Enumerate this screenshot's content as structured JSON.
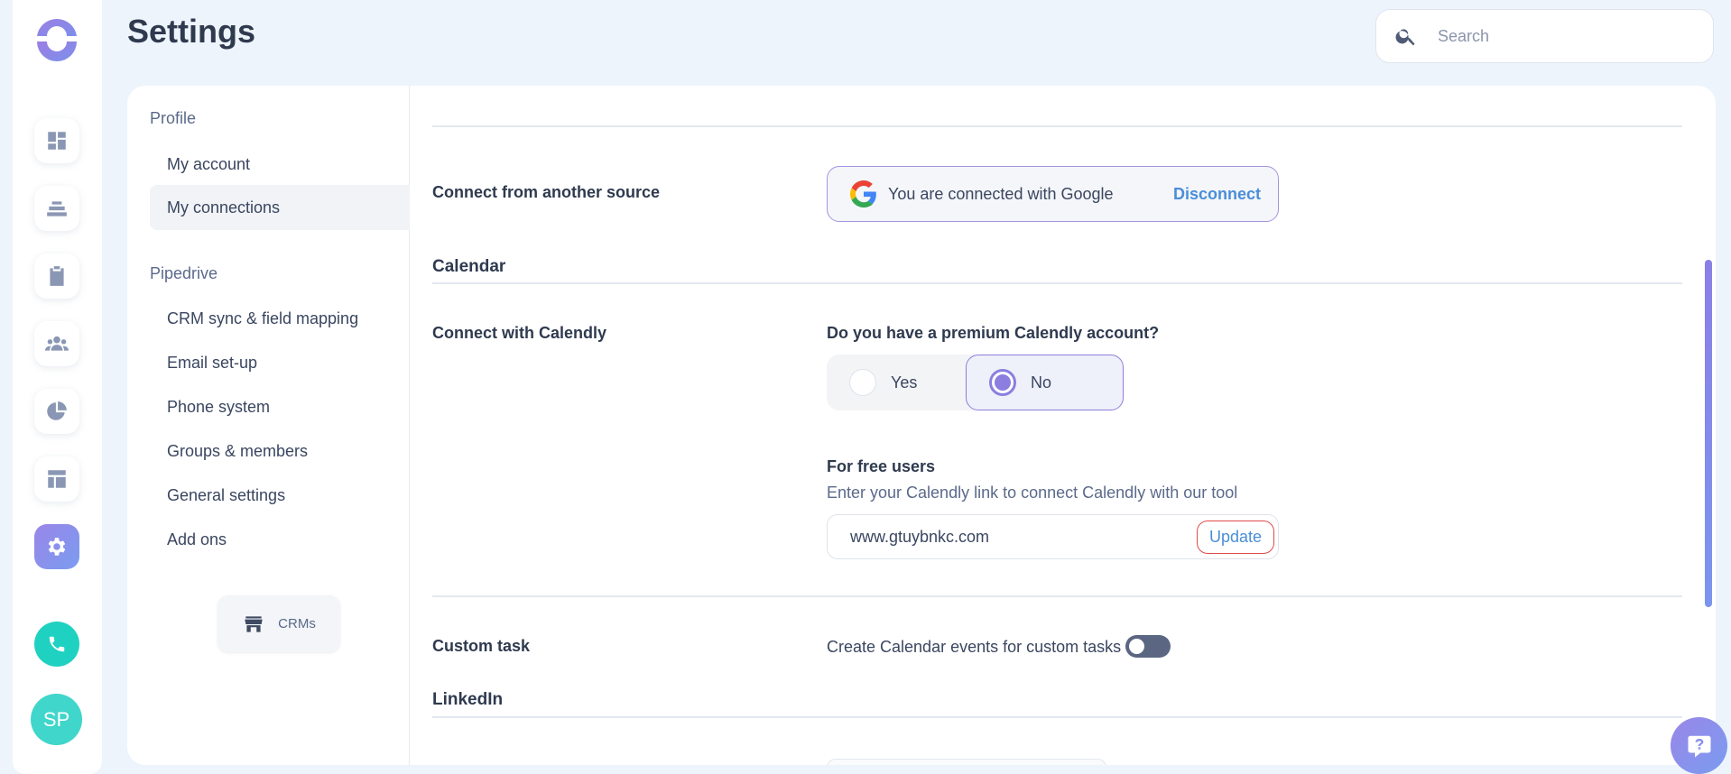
{
  "header": {
    "title": "Settings",
    "search_placeholder": "Search"
  },
  "rail": {
    "avatar_initials": "SP",
    "items": [
      "dashboard-icon",
      "inbox-icon",
      "clipboard-icon",
      "team-icon",
      "pie-chart-icon",
      "layout-icon",
      "gear-icon",
      "phone-icon"
    ]
  },
  "subnav": {
    "group_profile": "Profile",
    "my_account": "My account",
    "my_connections": "My connections",
    "group_pipedrive": "Pipedrive",
    "crm_sync": "CRM sync & field mapping",
    "email_setup": "Email set-up",
    "phone_system": "Phone system",
    "groups_members": "Groups & members",
    "general_settings": "General settings",
    "add_ons": "Add ons",
    "crms_button": "CRMs"
  },
  "content": {
    "connect_source_label": "Connect from another source",
    "google_connected_text": "You are connected with Google",
    "disconnect_label": "Disconnect",
    "calendar_title": "Calendar",
    "connect_calendly_label": "Connect with Calendly",
    "premium_question": "Do you have a premium Calendly account?",
    "option_yes": "Yes",
    "option_no": "No",
    "selected_option": "No",
    "free_users_title": "For free users",
    "free_users_desc": "Enter your Calendly link to connect Calendly with our tool",
    "calendly_link_value": "www.gtuybnkc.com",
    "update_label": "Update",
    "custom_task_label": "Custom task",
    "custom_task_toggle_text": "Create Calendar events for custom tasks",
    "custom_task_toggle_on": false,
    "linkedin_title": "LinkedIn"
  },
  "colors": {
    "accent": "#8a7fe0",
    "link": "#4a8ed8",
    "phone": "#1fd1c1",
    "danger_border": "#e04b4b"
  }
}
